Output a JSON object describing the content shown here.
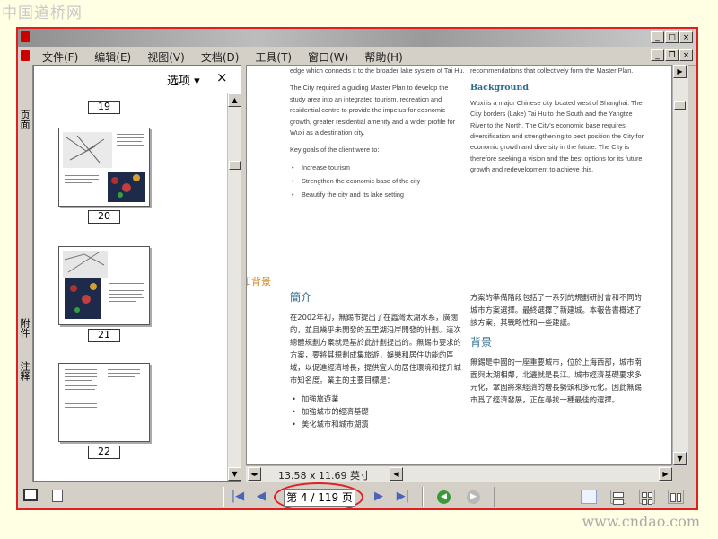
{
  "watermark_top": "中国道桥网",
  "watermark_bottom": "www.cndao.com",
  "menu": {
    "items": [
      "文件(F)",
      "编辑(E)",
      "视图(V)",
      "文档(D)",
      "工具(T)",
      "窗口(W)",
      "帮助(H)"
    ]
  },
  "window_controls": {
    "minimize": "_",
    "maximize": "□",
    "close": "×",
    "restore": "❐"
  },
  "left_tabs": {
    "pages": "页面",
    "attachments": "附件",
    "comments": "注释"
  },
  "nav_panel": {
    "options_label": "选项",
    "options_caret": "▾",
    "close": "×",
    "thumbs": [
      {
        "page": "19"
      },
      {
        "page": "20"
      },
      {
        "page": "21"
      },
      {
        "page": "22"
      }
    ]
  },
  "document": {
    "en_left": {
      "p1": "edge which connects it to the broader lake system of Tai Hu.",
      "p2": "The City required a guiding Master Plan to develop the study area into an integrated tourism, recreation and residential centre to provide the impetus for economic growth, greater residential amenity and a wider profile for Wuxi as a destination city.",
      "p3": "Key goals of the client were to:",
      "bullets": [
        "Increase tourism",
        "Strengthen the economic base of the city",
        "Beautify the city and its lake setting"
      ]
    },
    "en_right": {
      "p1": "recommendations that collectively form the Master Plan.",
      "heading": "Background",
      "p2": "Wuxi is a major Chinese city located west of Shanghai. The City borders (Lake) Tai Hu to the South and the Yangtze River to the North. The City's economic base requires diversification and strengthening to best position the City for economic growth and diversity in the future. The City is therefore seeking a vision and the best options for its future growth and redevelopment to achieve this."
    },
    "section_label": "和背景",
    "cn_left": {
      "heading": "簡介",
      "p1": "在2002年初，無錫市提出了在蠡灣太湖水系，廣闊的，並且幾乎未開發的五里湖沿岸開發的計劃。這次總體規劃方案就是基於此計劃提出的。無錫市要求的方案，要將其規劃成集旅遊，娛樂和居住功能的區域，以促進經濟增長，提供宜人的居住環境和提升城市知名度。業主的主要目標是：",
      "bullets": [
        "加強旅遊業",
        "加強城市的經濟基礎",
        "美化城市和城市湖濱"
      ]
    },
    "cn_right": {
      "p1": "方案的準備階段包括了一系列的規劃研討會和不同的城市方案選擇。最終選擇了新建城。本報告書概述了該方案，其戰略性和一些建議。",
      "heading": "背景",
      "p2": "無錫是中國的一座重要城市，位於上海西部，城市南面與太湖相鄰，北邊就是長江。城市經濟基礎要求多元化，鞏固將來經濟的增長勢頭和多元化。因此無錫市爲了經濟發展，正在尋找一種最佳的選擇。"
    },
    "page_size": "13.58 x 11.69 英寸"
  },
  "statusbar": {
    "page_indicator": "第 4 / 119 页",
    "first": "|◀",
    "prev": "◀",
    "next": "▶",
    "last": "▶|",
    "back": "◀",
    "forward": "▶"
  },
  "colors": {
    "frame_red": "#e02020",
    "heading_blue": "#2b6b8f",
    "section_orange": "#d88b2d",
    "nav_blue": "#4a64b8",
    "back_green": "#3a9a3a"
  }
}
